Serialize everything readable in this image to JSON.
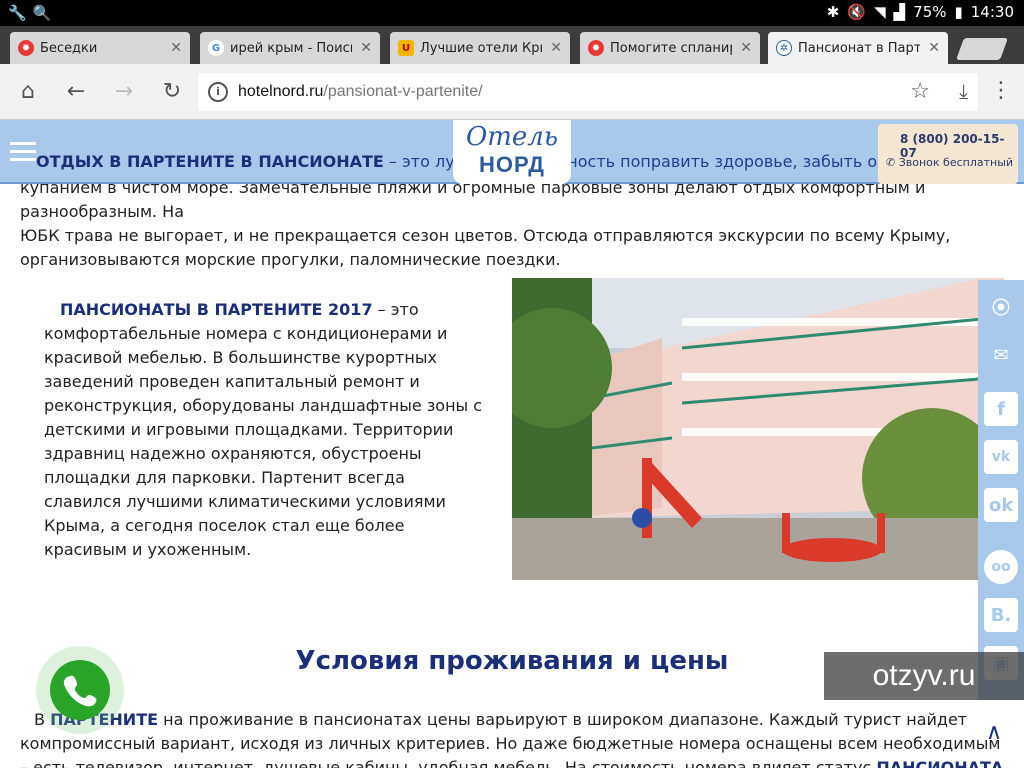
{
  "statusbar": {
    "battery": "75%",
    "time": "14:30"
  },
  "tabs": [
    {
      "title": "Беседки",
      "icon": "red-gear-icon",
      "active": false
    },
    {
      "title": "ирей крым - Поиск",
      "icon": "google-icon",
      "active": false
    },
    {
      "title": "Лучшие отели Крым",
      "icon": "u-icon",
      "active": false
    },
    {
      "title": "Помогите спланиро",
      "icon": "red-gear-icon",
      "active": false
    },
    {
      "title": "Пансионат в Парте",
      "icon": "globe-icon",
      "active": true
    }
  ],
  "address": {
    "host": "hotelnord.ru",
    "path": "/pansionat-v-partenite/"
  },
  "site": {
    "logo_top": "Отель",
    "logo_bottom": "НОРД",
    "phone": "8 (800) 200-15-07",
    "phone_note": "Звонок бесплатный",
    "intro_bold": "ОТДЫХ В ПАРТЕНИТЕ В ПАНСИОНАТЕ",
    "intro_rest": " – это лучшая возможность поправить здоровье, забыть о стрессах, на"
  },
  "content": {
    "p1_line1": "купанием в чистом море. Замечательные пляжи и огромные парковые зоны делают отдых комфортным и разнообразным. На",
    "p1_line2": "ЮБК трава не выгорает, и не прекращается сезон цветов. Отсюда отправляются экскурсии по всему Крыму,",
    "p1_line3": "организовываются морские прогулки, паломнические поездки.",
    "p2_bold": "ПАНСИОНАТЫ В ПАРТЕНИТЕ 2017",
    "p2_rest": " – это комфортабельные номера с кондиционерами и красивой мебелью. В большинстве курортных заведений проведен капитальный ремонт и реконструкция, оборудованы ландшафтные зоны с детскими и игровыми площадками. Территории здравниц надежно охраняются, обустроены площадки для парковки. Партенит всегда славился лучшими климатическими условиями Крыма, а сегодня поселок стал еще более красивым и ухоженным.",
    "heading": "Условия проживания и цены",
    "p3_start": "В ",
    "p3_bold1": "ПАРТЕНИТЕ",
    "p3_mid": " на проживание в пансионатах цены варьируют в широком диапазоне. Каждый турист найдет компромиссный вариант, исходя из личных критериев. Но даже бюджетные номера оснащены всем необходимым – есть телевизор, интернет, душевые кабины, удобная мебель. На стоимость номера влияет статус ",
    "p3_bold2": "ПАНСИОНАТА ПАРТЕНИТА"
  },
  "social": [
    "map-pin-icon",
    "mail-icon",
    "facebook-icon",
    "vk-icon",
    "odnoklassniki-icon",
    "tripadvisor-icon",
    "booking-icon",
    "instagram-icon"
  ],
  "watermark": "otzyv.ru"
}
